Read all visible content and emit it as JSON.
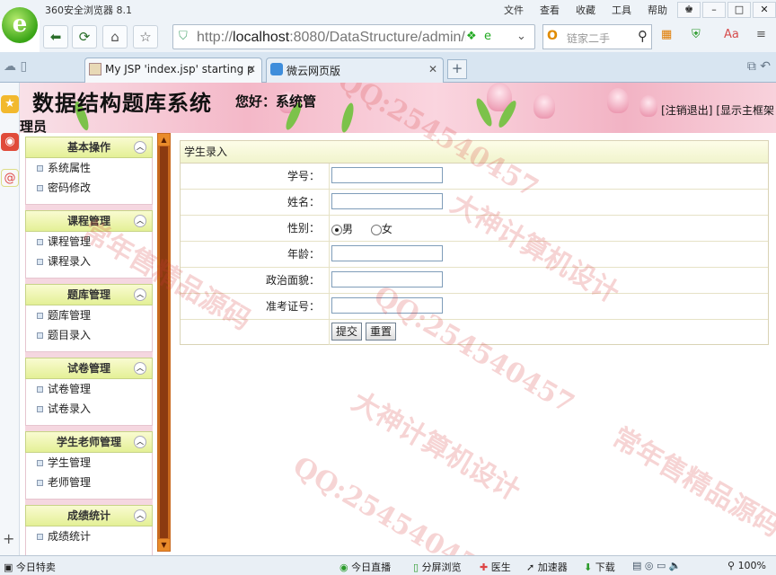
{
  "browser": {
    "title": "360安全浏览器 8.1",
    "menu": [
      "文件",
      "查看",
      "收藏",
      "工具",
      "帮助"
    ],
    "url_prefix": "http://",
    "url_host": "localhost",
    "url_rest": ":8080/DataStructure/admin/in",
    "search_placeholder": "链家二手",
    "tabs": [
      {
        "label": "My JSP 'index.jsp' starting p",
        "active": true
      },
      {
        "label": "微云网页版",
        "active": false
      }
    ]
  },
  "page": {
    "title": "数据结构题库系统",
    "greeting_line1": "您好：系统管",
    "greeting_line2": "理员",
    "links": [
      "[注销退出]",
      "[显示主框架"
    ]
  },
  "sidebar": [
    {
      "title": "基本操作",
      "items": [
        "系统属性",
        "密码修改"
      ]
    },
    {
      "title": "课程管理",
      "items": [
        "课程管理",
        "课程录入"
      ]
    },
    {
      "title": "题库管理",
      "items": [
        "题库管理",
        "题目录入"
      ]
    },
    {
      "title": "试卷管理",
      "items": [
        "试卷管理",
        "试卷录入"
      ]
    },
    {
      "title": "学生老师管理",
      "items": [
        "学生管理",
        "老师管理"
      ]
    },
    {
      "title": "成绩统计",
      "items": [
        "成绩统计"
      ]
    }
  ],
  "form": {
    "heading": "学生录入",
    "fields": [
      {
        "label": "学号：",
        "value": ""
      },
      {
        "label": "姓名：",
        "value": ""
      },
      {
        "label": "性别：",
        "value": ""
      },
      {
        "label": "年龄：",
        "value": ""
      },
      {
        "label": "政治面貌：",
        "value": ""
      },
      {
        "label": "准考证号：",
        "value": ""
      }
    ],
    "gender_options": [
      "男",
      "女"
    ],
    "gender_selected": "男",
    "submit_label": "提交",
    "reset_label": "重置"
  },
  "statusbar": {
    "left": "今日特卖",
    "items": [
      "今日直播",
      "分屏浏览",
      "医生",
      "加速器",
      "下载"
    ],
    "zoom": "100%"
  },
  "watermarks": [
    "大神计算机设计",
    "常年售精品源码",
    "QQ:254540457"
  ]
}
